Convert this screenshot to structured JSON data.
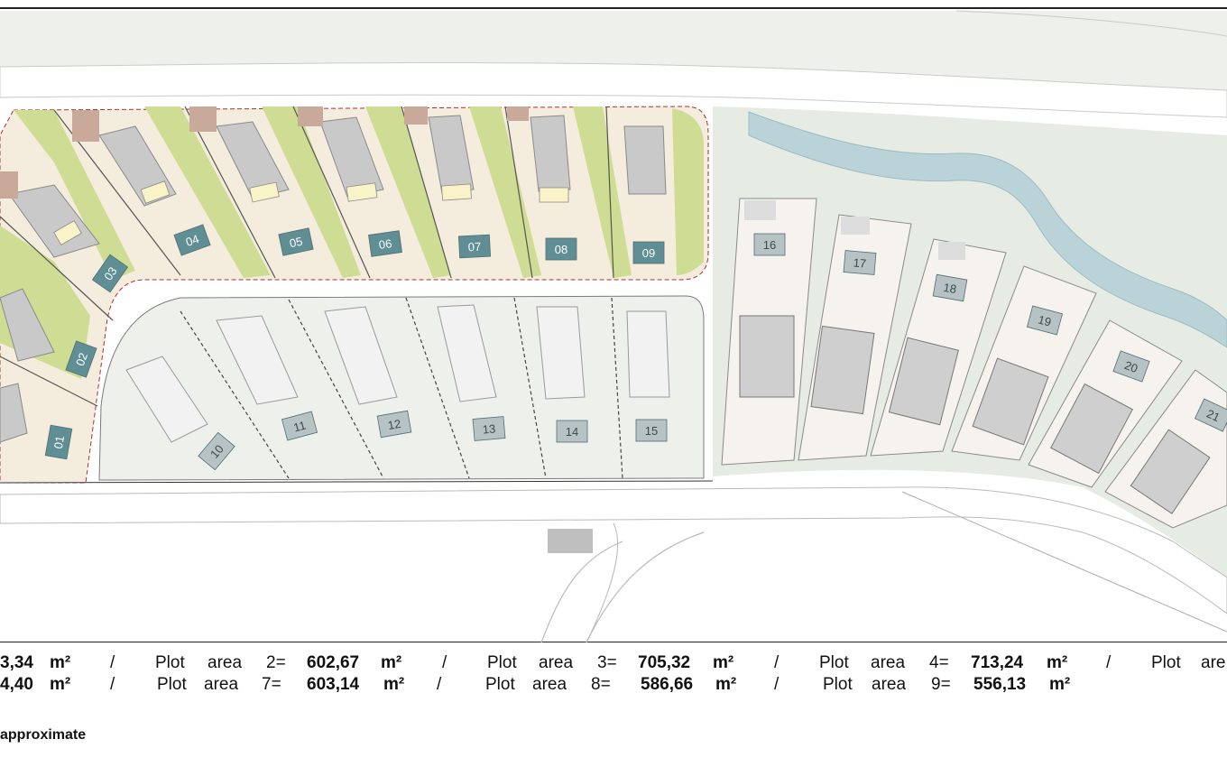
{
  "plots": [
    {
      "number": "01"
    },
    {
      "number": "02"
    },
    {
      "number": "03"
    },
    {
      "number": "04"
    },
    {
      "number": "05"
    },
    {
      "number": "06"
    },
    {
      "number": "07"
    },
    {
      "number": "08"
    },
    {
      "number": "09"
    },
    {
      "number": "10"
    },
    {
      "number": "11"
    },
    {
      "number": "12"
    },
    {
      "number": "13"
    },
    {
      "number": "14"
    },
    {
      "number": "15"
    },
    {
      "number": "16"
    },
    {
      "number": "17"
    },
    {
      "number": "18"
    },
    {
      "number": "19"
    },
    {
      "number": "20"
    },
    {
      "number": "21"
    }
  ],
  "legend": {
    "row1": {
      "a1_value": "3,34",
      "a1_unit": "m²",
      "sep1": "/",
      "a2_label": "Plot",
      "a2_word": "area",
      "a2_num": "2=",
      "a2_value": "602,67",
      "a2_unit": "m²",
      "sep2": "/",
      "a3_label": "Plot",
      "a3_word": "area",
      "a3_num": "3=",
      "a3_value": "705,32",
      "a3_unit": "m²",
      "sep3": "/",
      "a4_label": "Plot",
      "a4_word": "area",
      "a4_num": "4=",
      "a4_value": "713,24",
      "a4_unit": "m²",
      "sep4": "/",
      "a5_label": "Plot",
      "a5_word": "are"
    },
    "row2": {
      "a6_value": "4,40",
      "a6_unit": "m²",
      "sep1": "/",
      "a7_label": "Plot",
      "a7_word": "area",
      "a7_num": "7=",
      "a7_value": "603,14",
      "a7_unit": "m²",
      "sep2": "/",
      "a8_label": "Plot",
      "a8_word": "area",
      "a8_num": "8=",
      "a8_value": "586,66",
      "a8_unit": "m²",
      "sep3": "/",
      "a9_label": "Plot",
      "a9_word": "area",
      "a9_num": "9=",
      "a9_value": "556,13",
      "a9_unit": "m²"
    },
    "note": "approximate"
  },
  "colors": {
    "grass": "#cfdc93",
    "plot_label_teal": "#5f8f95",
    "plot_label_gray": "#b7c2c4",
    "river": "#b9d3d8",
    "boundary_dash": "#b03030"
  }
}
